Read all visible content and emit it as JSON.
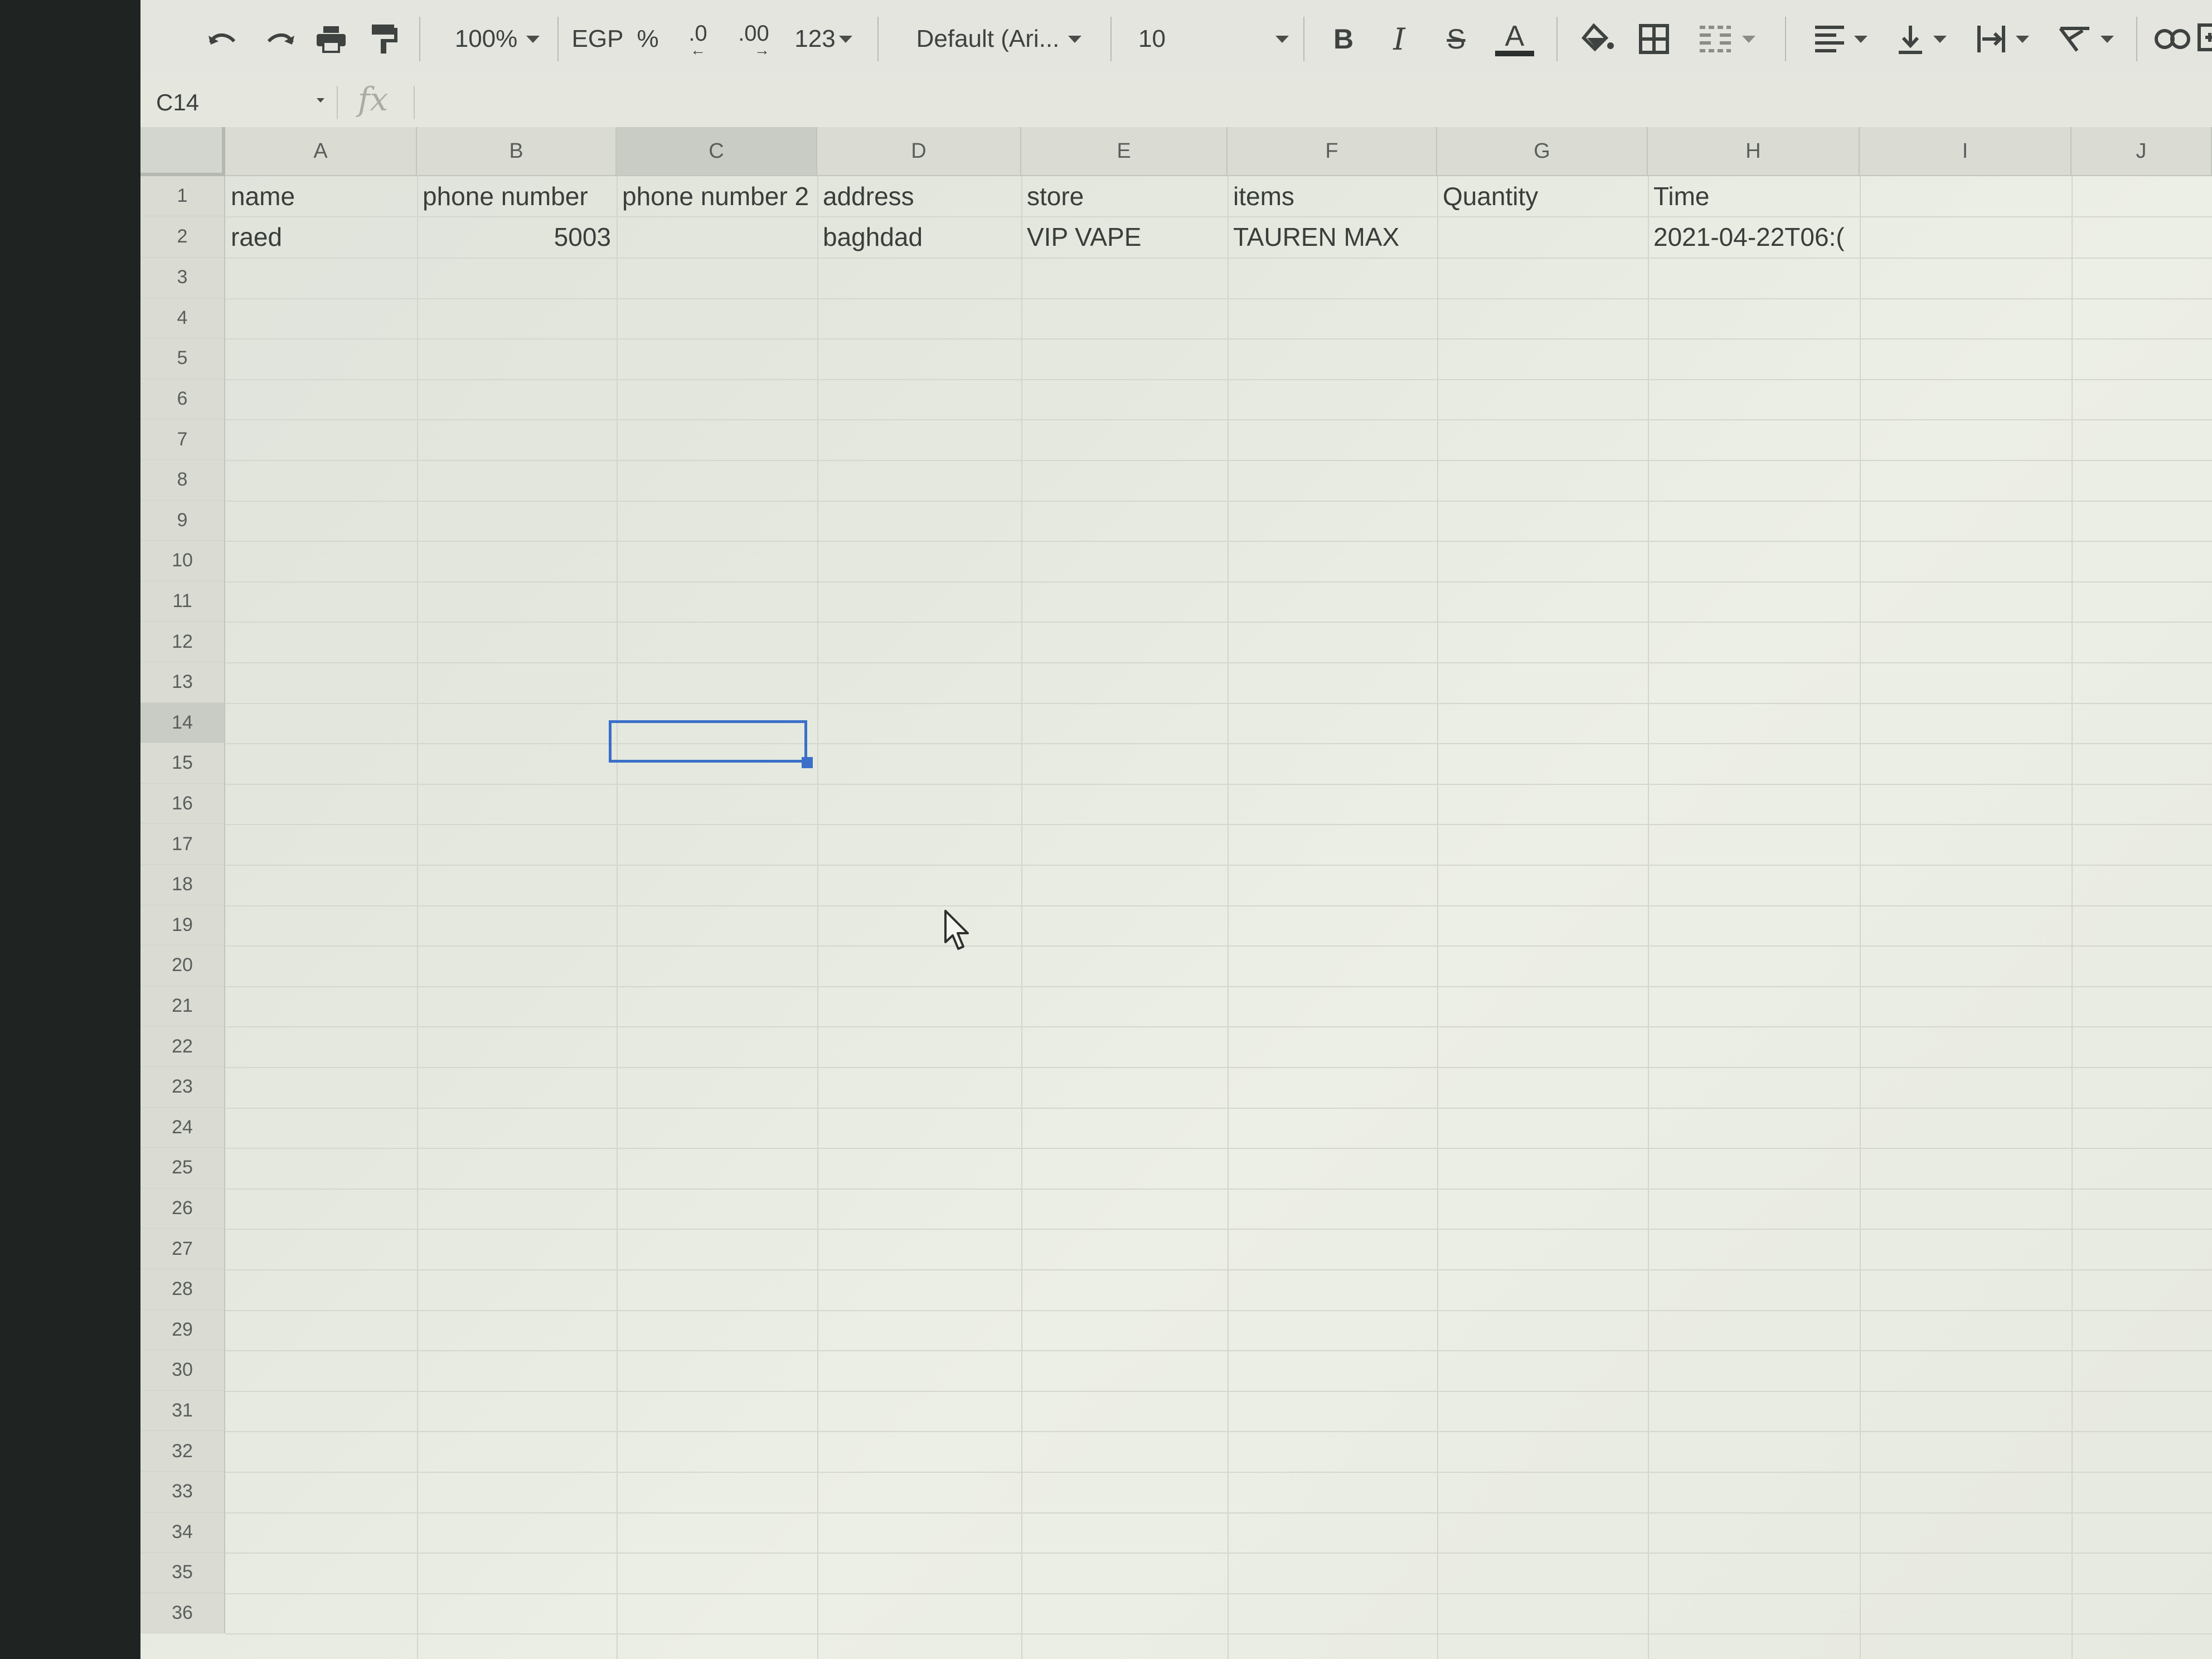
{
  "toolbar": {
    "zoom": "100%",
    "currency": "EGP",
    "percent": "%",
    "decrease_decimal": ".0",
    "increase_decimal": ".00",
    "more_formats": "123",
    "font": "Default (Ari...",
    "font_size": "10",
    "bold": "B",
    "italic": "I",
    "strikethrough": "S",
    "text_color": "A"
  },
  "formula_bar": {
    "name_box": "C14",
    "fx": "fx",
    "value": ""
  },
  "columns": [
    "A",
    "B",
    "C",
    "D",
    "E",
    "F",
    "G",
    "H",
    "I",
    "J"
  ],
  "rows": [
    "1",
    "2",
    "3",
    "4",
    "5",
    "6",
    "7",
    "8",
    "9",
    "10",
    "11",
    "12",
    "13",
    "14",
    "15",
    "16",
    "17",
    "18",
    "19",
    "20",
    "21",
    "22",
    "23",
    "24",
    "25",
    "26",
    "27",
    "28",
    "29",
    "30",
    "31",
    "32",
    "33",
    "34",
    "35",
    "36"
  ],
  "sheet": {
    "header_row": [
      "name",
      "phone number",
      "phone number 2",
      "address",
      "store",
      "items",
      "Quantity",
      "Time"
    ],
    "data_row": [
      "raed",
      "5003",
      "",
      "baghdad",
      "VIP VAPE",
      "TAUREN MAX",
      "",
      "2021-04-22T06:("
    ]
  },
  "selection": {
    "cell": "C14"
  },
  "colors": {
    "selection": "#3b6fc9",
    "header_bg": "#dadcd4"
  }
}
